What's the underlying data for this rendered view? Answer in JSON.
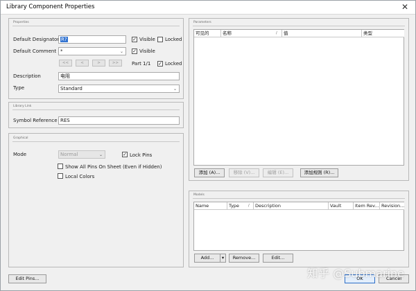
{
  "window": {
    "title": "Library Component Properties",
    "close_glyph": "✕"
  },
  "properties": {
    "section_label": "Properties",
    "designator_label": "Default Designator",
    "designator_value": "R?",
    "designator_visible_label": "Visible",
    "designator_visible_checked": "✓",
    "designator_locked_label": "Locked",
    "comment_label": "Default Comment",
    "comment_value": "*",
    "comment_visible_label": "Visible",
    "comment_visible_checked": "✓",
    "nav_first": "<<",
    "nav_prev": "<",
    "nav_next": ">",
    "nav_last": ">>",
    "part_label": "Part 1/1",
    "part_locked_label": "Locked",
    "part_locked_checked": "✓",
    "description_label": "Description",
    "description_value": "电阻",
    "type_label": "Type",
    "type_value": "Standard"
  },
  "library_link": {
    "section_label": "Library Link",
    "symbol_ref_label": "Symbol Reference",
    "symbol_ref_value": "RES"
  },
  "graphical": {
    "section_label": "Graphical",
    "mode_label": "Mode",
    "mode_value": "Normal",
    "lock_pins_label": "Lock Pins",
    "lock_pins_checked": "✓",
    "show_all_pins_label": "Show All Pins On Sheet (Even if Hidden)",
    "local_colors_label": "Local Colors"
  },
  "parameters": {
    "section_label": "Parameters",
    "columns": [
      "可见的",
      "名称",
      "/",
      "值",
      "类型"
    ],
    "add_button": "添加 (A)...",
    "remove_button": "移除 (V)...",
    "edit_button": "编辑 (E)...",
    "add_rule_button": "添加规则 (R)..."
  },
  "models": {
    "section_label": "Models",
    "columns": [
      "Name",
      "Type",
      "/",
      "Description",
      "Vault",
      "Item Rev...",
      "Revision..."
    ],
    "add_button": "Add...",
    "add_dropdown": "▾",
    "remove_button": "Remove...",
    "edit_button": "Edit..."
  },
  "footer": {
    "edit_pins_button": "Edit Pins...",
    "ok_button": "OK",
    "cancel_button": "Cancel"
  },
  "watermark": "知乎 @Submarine"
}
